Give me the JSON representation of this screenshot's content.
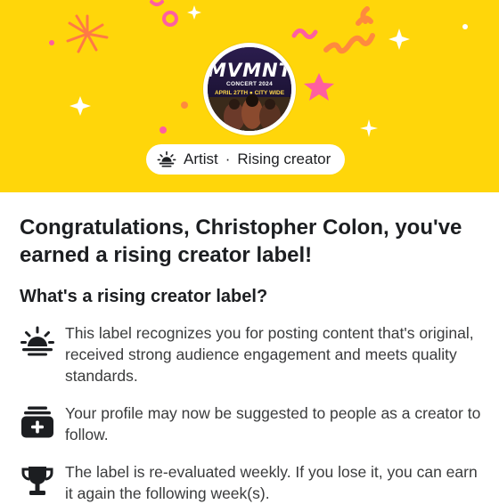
{
  "profile": {
    "category": "Artist",
    "separator": "·",
    "label_name": "Rising creator",
    "avatar_poster": {
      "title": "MVMNT",
      "subtitle": "CONCERT 2024",
      "date_line": "APRIL 27TH ● CITY WIDE"
    }
  },
  "headline": "Congratulations, Christopher Colon, you've earned a rising creator label!",
  "section_title": "What's a rising creator label?",
  "items": [
    {
      "icon": "sunrise-icon",
      "text": "This label recognizes you for posting content that's original, received strong audience engagement and meets quality standards."
    },
    {
      "icon": "add-to-feed-icon",
      "text": "Your profile may now be suggested to people as a creator to follow."
    },
    {
      "icon": "trophy-icon",
      "text": "The label is re-evaluated weekly. If you lose it, you can earn it again the following week(s)."
    }
  ],
  "colors": {
    "hero_background": "#ffd60a",
    "confetti_pink": "#ff5fa0",
    "confetti_orange": "#ff8a3d",
    "text_primary": "#1c1e21"
  }
}
